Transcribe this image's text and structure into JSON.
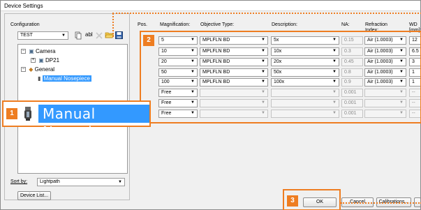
{
  "window": {
    "title": "Device Settings"
  },
  "config": {
    "label": "Configuration",
    "selected": "TEST",
    "toolbar_icons": [
      "copy-icon",
      "rename-icon",
      "delete-icon",
      "open-folder-icon",
      "save-icon"
    ],
    "rename_text": "abl"
  },
  "tree": {
    "items": [
      {
        "label": "Camera",
        "icon": "camera-icon",
        "expander": "−"
      },
      {
        "label": "DP21",
        "icon": "camera-icon",
        "expander": "+"
      },
      {
        "label": "General",
        "icon": "microscope-icon",
        "expander": "−"
      },
      {
        "label": "Manual Nosepiece",
        "icon": "nosepiece-icon"
      }
    ]
  },
  "sort": {
    "label": "Sort by:",
    "value": "Lightpath"
  },
  "device_list_button": "Device List...",
  "zoom_callout": {
    "label": "Manual Nosepiece"
  },
  "callouts": [
    "1",
    "2",
    "3"
  ],
  "table": {
    "headers": {
      "pos": "Pos.",
      "magnification": "Magnification:",
      "objective_type": "Objective Type:",
      "description": "Description:",
      "na": "NA:",
      "refraction": "Refraction Index:",
      "wd": "WD [mm]:"
    },
    "rows": [
      {
        "magnification": "5",
        "objective": "MPLFLN BD",
        "description": "5x",
        "na": "0.15",
        "refraction": "Air (1.0003)",
        "wd": "12"
      },
      {
        "magnification": "10",
        "objective": "MPLFLN BD",
        "description": "10x",
        "na": "0.3",
        "refraction": "Air (1.0003)",
        "wd": "6.5"
      },
      {
        "magnification": "20",
        "objective": "MPLFLN BD",
        "description": "20x",
        "na": "0.45",
        "refraction": "Air (1.0003)",
        "wd": "3"
      },
      {
        "magnification": "50",
        "objective": "MPLFLN BD",
        "description": "50x",
        "na": "0.8",
        "refraction": "Air (1.0003)",
        "wd": "1"
      },
      {
        "magnification": "100",
        "objective": "MPLFLN BD",
        "description": "100x",
        "na": "0.9",
        "refraction": "Air (1.0003)",
        "wd": "1"
      },
      {
        "magnification": "Free",
        "objective": "",
        "description": "",
        "na": "0.001",
        "refraction": "",
        "wd": "--"
      },
      {
        "magnification": "Free",
        "objective": "",
        "description": "",
        "na": "0.001",
        "refraction": "",
        "wd": "--"
      },
      {
        "magnification": "Free",
        "objective": "",
        "description": "",
        "na": "0.001",
        "refraction": "",
        "wd": "--"
      }
    ]
  },
  "buttons": {
    "ok": "OK",
    "cancel": "Cancel",
    "calibrations": "Calibrations..."
  },
  "colors": {
    "accent": "#ee7d21",
    "selection": "#3399ff"
  }
}
